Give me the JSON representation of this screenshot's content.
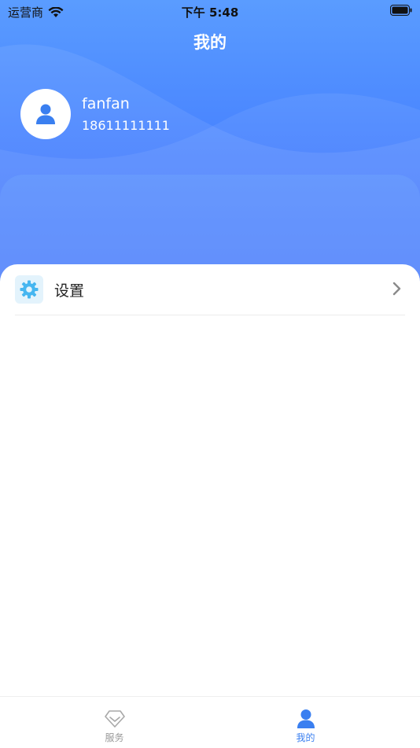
{
  "status_bar": {
    "carrier": "运营商",
    "time": "下午 5:48"
  },
  "header": {
    "title": "我的"
  },
  "profile": {
    "username": "fanfan",
    "phone": "18611111111"
  },
  "menu": {
    "items": [
      {
        "label": "设置",
        "icon": "gear-icon"
      }
    ]
  },
  "tabbar": {
    "tabs": [
      {
        "label": "服务",
        "icon": "diamond-icon",
        "active": false
      },
      {
        "label": "我的",
        "icon": "person-icon",
        "active": true
      }
    ]
  },
  "colors": {
    "header_gradient_top": "#5a9cff",
    "header_gradient_bottom": "#3f6dfa",
    "active_tab": "#3a7ff0",
    "inactive_tab": "#999999"
  }
}
